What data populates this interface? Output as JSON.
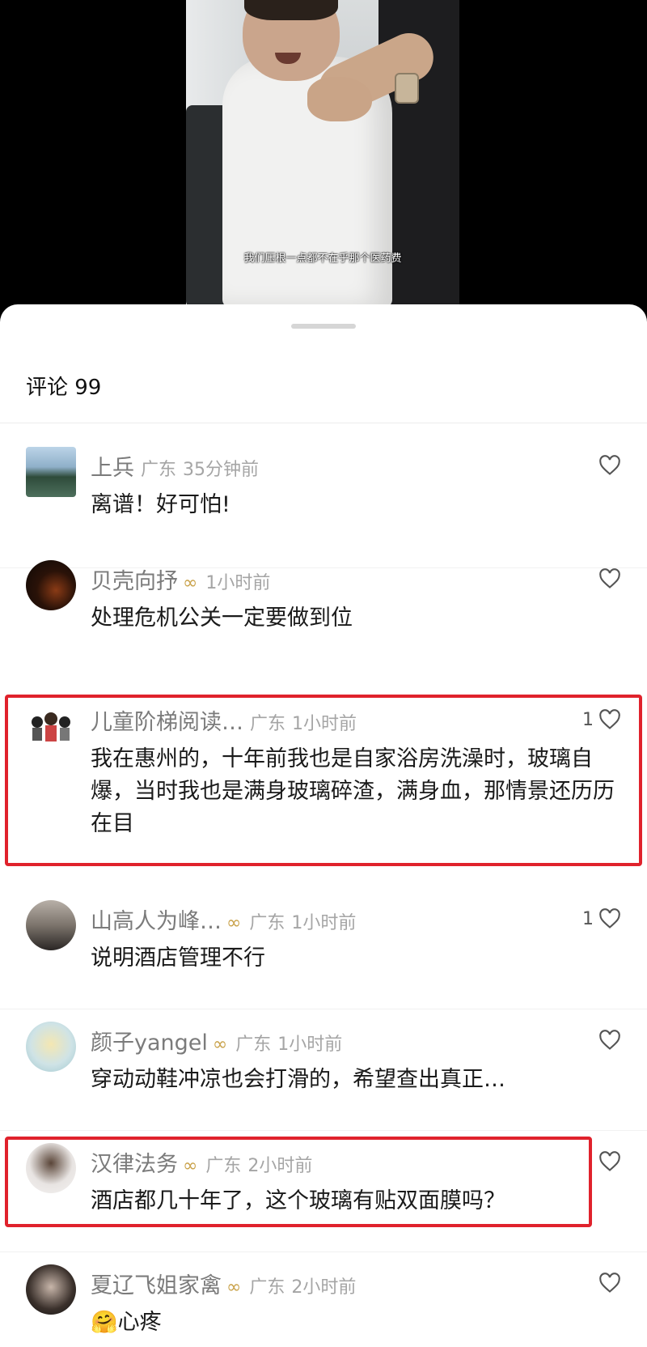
{
  "video": {
    "caption": "我们压根一点都不在乎那个医药费"
  },
  "comments_panel": {
    "title": "评论 99",
    "items": [
      {
        "name": "上兵",
        "vip": false,
        "location": "广东",
        "time": "35分钟前",
        "text": "离谱！好可怕!",
        "likes": ""
      },
      {
        "name": "贝壳向抒",
        "vip": true,
        "location": "",
        "time": "1小时前",
        "text": "处理危机公关一定要做到位",
        "likes": ""
      },
      {
        "name": "儿童阶梯阅读…",
        "vip": false,
        "location": "广东",
        "time": "1小时前",
        "text": "我在惠州的，十年前我也是自家浴房洗澡时，玻璃自爆，当时我也是满身玻璃碎渣，满身血，那情景还历历在目",
        "likes": "1"
      },
      {
        "name": "山高人为峰…",
        "vip": true,
        "location": "广东",
        "time": "1小时前",
        "text": "说明酒店管理不行",
        "likes": "1"
      },
      {
        "name": "颜子yangel",
        "vip": true,
        "location": "广东",
        "time": "1小时前",
        "text": "穿动动鞋冲凉也会打滑的，希望查出真正…",
        "likes": ""
      },
      {
        "name": "汉律法务",
        "vip": true,
        "location": "广东",
        "time": "2小时前",
        "text": "酒店都几十年了，这个玻璃有贴双面膜吗？",
        "likes": ""
      },
      {
        "name": "夏辽飞姐家禽",
        "vip": true,
        "location": "广东",
        "time": "2小时前",
        "text": "心疼",
        "emoji": "🤗",
        "likes": ""
      }
    ]
  },
  "colors": {
    "highlight": "#e0222c",
    "vip": "#c9a24a"
  }
}
